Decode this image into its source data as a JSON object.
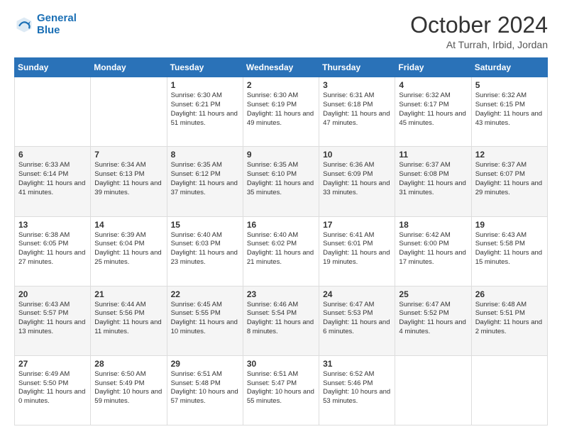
{
  "header": {
    "logo_line1": "General",
    "logo_line2": "Blue",
    "title": "October 2024",
    "subtitle": "At Turrah, Irbid, Jordan"
  },
  "days_of_week": [
    "Sunday",
    "Monday",
    "Tuesday",
    "Wednesday",
    "Thursday",
    "Friday",
    "Saturday"
  ],
  "weeks": [
    [
      {
        "day": "",
        "info": ""
      },
      {
        "day": "",
        "info": ""
      },
      {
        "day": "1",
        "sunrise": "6:30 AM",
        "sunset": "6:21 PM",
        "daylight": "11 hours and 51 minutes."
      },
      {
        "day": "2",
        "sunrise": "6:30 AM",
        "sunset": "6:19 PM",
        "daylight": "11 hours and 49 minutes."
      },
      {
        "day": "3",
        "sunrise": "6:31 AM",
        "sunset": "6:18 PM",
        "daylight": "11 hours and 47 minutes."
      },
      {
        "day": "4",
        "sunrise": "6:32 AM",
        "sunset": "6:17 PM",
        "daylight": "11 hours and 45 minutes."
      },
      {
        "day": "5",
        "sunrise": "6:32 AM",
        "sunset": "6:15 PM",
        "daylight": "11 hours and 43 minutes."
      }
    ],
    [
      {
        "day": "6",
        "sunrise": "6:33 AM",
        "sunset": "6:14 PM",
        "daylight": "11 hours and 41 minutes."
      },
      {
        "day": "7",
        "sunrise": "6:34 AM",
        "sunset": "6:13 PM",
        "daylight": "11 hours and 39 minutes."
      },
      {
        "day": "8",
        "sunrise": "6:35 AM",
        "sunset": "6:12 PM",
        "daylight": "11 hours and 37 minutes."
      },
      {
        "day": "9",
        "sunrise": "6:35 AM",
        "sunset": "6:10 PM",
        "daylight": "11 hours and 35 minutes."
      },
      {
        "day": "10",
        "sunrise": "6:36 AM",
        "sunset": "6:09 PM",
        "daylight": "11 hours and 33 minutes."
      },
      {
        "day": "11",
        "sunrise": "6:37 AM",
        "sunset": "6:08 PM",
        "daylight": "11 hours and 31 minutes."
      },
      {
        "day": "12",
        "sunrise": "6:37 AM",
        "sunset": "6:07 PM",
        "daylight": "11 hours and 29 minutes."
      }
    ],
    [
      {
        "day": "13",
        "sunrise": "6:38 AM",
        "sunset": "6:05 PM",
        "daylight": "11 hours and 27 minutes."
      },
      {
        "day": "14",
        "sunrise": "6:39 AM",
        "sunset": "6:04 PM",
        "daylight": "11 hours and 25 minutes."
      },
      {
        "day": "15",
        "sunrise": "6:40 AM",
        "sunset": "6:03 PM",
        "daylight": "11 hours and 23 minutes."
      },
      {
        "day": "16",
        "sunrise": "6:40 AM",
        "sunset": "6:02 PM",
        "daylight": "11 hours and 21 minutes."
      },
      {
        "day": "17",
        "sunrise": "6:41 AM",
        "sunset": "6:01 PM",
        "daylight": "11 hours and 19 minutes."
      },
      {
        "day": "18",
        "sunrise": "6:42 AM",
        "sunset": "6:00 PM",
        "daylight": "11 hours and 17 minutes."
      },
      {
        "day": "19",
        "sunrise": "6:43 AM",
        "sunset": "5:58 PM",
        "daylight": "11 hours and 15 minutes."
      }
    ],
    [
      {
        "day": "20",
        "sunrise": "6:43 AM",
        "sunset": "5:57 PM",
        "daylight": "11 hours and 13 minutes."
      },
      {
        "day": "21",
        "sunrise": "6:44 AM",
        "sunset": "5:56 PM",
        "daylight": "11 hours and 11 minutes."
      },
      {
        "day": "22",
        "sunrise": "6:45 AM",
        "sunset": "5:55 PM",
        "daylight": "11 hours and 10 minutes."
      },
      {
        "day": "23",
        "sunrise": "6:46 AM",
        "sunset": "5:54 PM",
        "daylight": "11 hours and 8 minutes."
      },
      {
        "day": "24",
        "sunrise": "6:47 AM",
        "sunset": "5:53 PM",
        "daylight": "11 hours and 6 minutes."
      },
      {
        "day": "25",
        "sunrise": "6:47 AM",
        "sunset": "5:52 PM",
        "daylight": "11 hours and 4 minutes."
      },
      {
        "day": "26",
        "sunrise": "6:48 AM",
        "sunset": "5:51 PM",
        "daylight": "11 hours and 2 minutes."
      }
    ],
    [
      {
        "day": "27",
        "sunrise": "6:49 AM",
        "sunset": "5:50 PM",
        "daylight": "11 hours and 0 minutes."
      },
      {
        "day": "28",
        "sunrise": "6:50 AM",
        "sunset": "5:49 PM",
        "daylight": "10 hours and 59 minutes."
      },
      {
        "day": "29",
        "sunrise": "6:51 AM",
        "sunset": "5:48 PM",
        "daylight": "10 hours and 57 minutes."
      },
      {
        "day": "30",
        "sunrise": "6:51 AM",
        "sunset": "5:47 PM",
        "daylight": "10 hours and 55 minutes."
      },
      {
        "day": "31",
        "sunrise": "6:52 AM",
        "sunset": "5:46 PM",
        "daylight": "10 hours and 53 minutes."
      },
      {
        "day": "",
        "info": ""
      },
      {
        "day": "",
        "info": ""
      }
    ]
  ]
}
